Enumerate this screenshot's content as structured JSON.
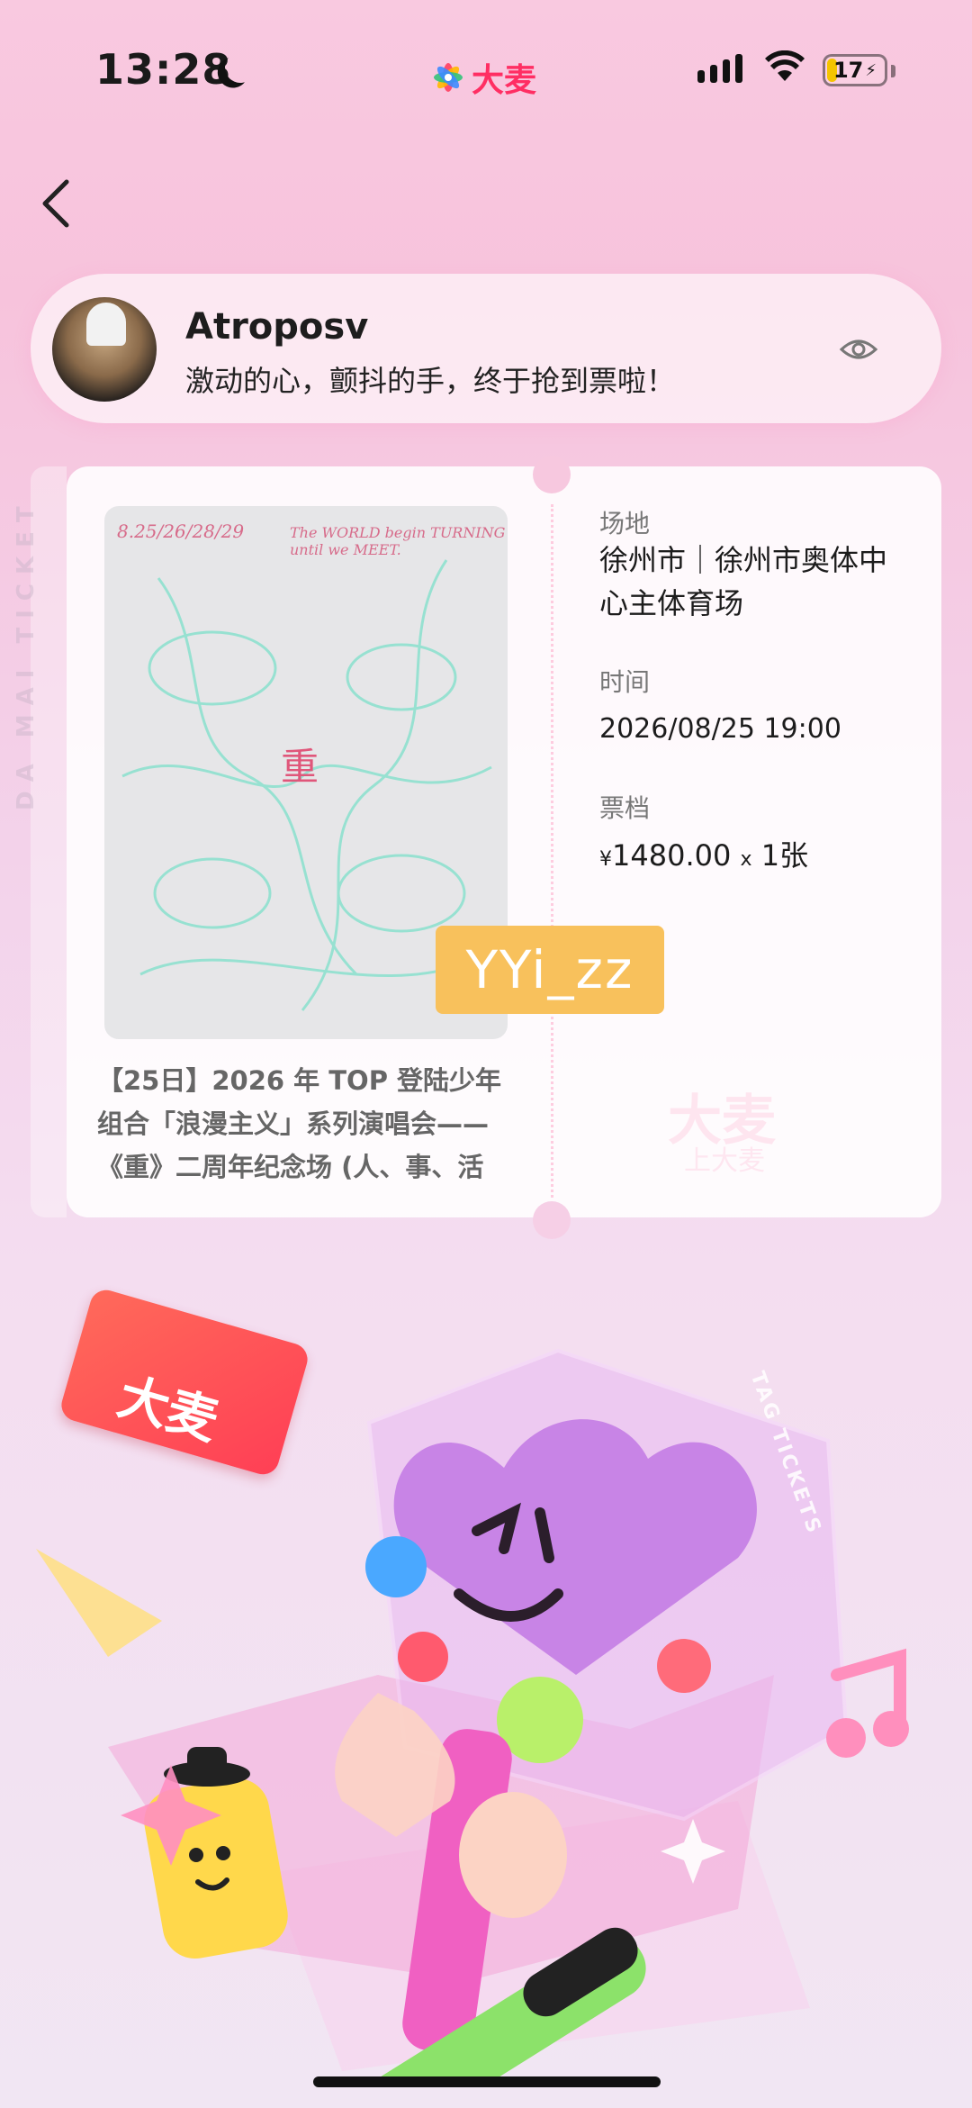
{
  "status_bar": {
    "time": "13:28",
    "brand": "大麦",
    "battery": "17"
  },
  "user": {
    "name": "Atroposv",
    "message": "激动的心，颤抖的手，终于抢到票啦！"
  },
  "ticket": {
    "side_label": "DA MAI TICKET",
    "venue_label": "场地",
    "venue_value": "徐州市｜徐州市奥体中心主体育场",
    "time_label": "时间",
    "time_value": "2026/08/25 19:00",
    "tier_label": "票档",
    "price_currency": "¥",
    "price": "1480.00",
    "qty_sep": "x",
    "quantity": "1张",
    "event_title": "【25日】2026 年 TOP 登陆少年组合「浪漫主义」系列演唱会——《重》二周年纪念场 (人、事、活",
    "poster": {
      "dates": "8.25/26/28/29",
      "tagline": "The WORLD begin TURNING until we MEET.",
      "title_char": "重"
    },
    "watermark_brand": "大麦",
    "watermark_sub": "上大麦"
  },
  "overlay_watermark": "YYi_zz",
  "illustration": {
    "sign_text": "大麦",
    "tag_tickets": "TAG TICKETS"
  },
  "colors": {
    "brand_red": "#ff2e63",
    "background_pink": "#f9c9e0",
    "watermark_orange": "#f8c15c"
  }
}
